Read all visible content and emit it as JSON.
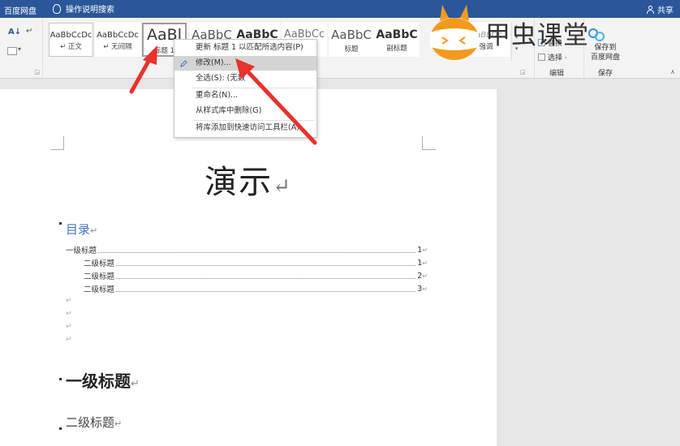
{
  "topbar": {
    "baidu_label": "百度网盘",
    "tell_me": "操作说明搜索",
    "share_label": "共享"
  },
  "ribbon": {
    "styles": [
      {
        "preview": "AaBbCcDc",
        "name": "↵ 正文"
      },
      {
        "preview": "AaBbCcDc",
        "name": "↵ 无间隔"
      },
      {
        "preview": "AaBl",
        "name": "标题 1"
      },
      {
        "preview": "AaBbC",
        "name": ""
      },
      {
        "preview": "AaBbC",
        "name": ""
      },
      {
        "preview": "AaBbCc",
        "name": ""
      },
      {
        "preview": "AaBbC",
        "name": "标题"
      },
      {
        "preview": "AaBbC",
        "name": "副标题"
      },
      {
        "preview": "AaBbDc",
        "name": "强调"
      }
    ],
    "editing": {
      "replace": "替换",
      "select": "选择 ·",
      "group_label": "编辑"
    },
    "save": {
      "line1": "保存到",
      "line2": "百度网盘",
      "group_label": "保存"
    }
  },
  "context_menu": {
    "items": [
      "更新 标题 1 以匹配所选内容(P)",
      "修改(M)...",
      "全选(S): (无数",
      "重命名(N)...",
      "从样式库中删除(G)",
      "将库添加到快速访问工具栏(A)"
    ]
  },
  "document": {
    "title": "演示",
    "toc_heading": "目录",
    "toc_rows": [
      {
        "text": "一级标题",
        "page": "1"
      },
      {
        "text": "二级标题",
        "page": "1"
      },
      {
        "text": "二级标题",
        "page": "2"
      },
      {
        "text": "二级标题",
        "page": "3"
      }
    ],
    "heading1": "一级标题",
    "heading2": "二级标题",
    "para_mark": "↵"
  },
  "logo": {
    "text": "甲虫课堂"
  },
  "colors": {
    "accent_blue": "#2b579a",
    "arrow_red": "#e8322b",
    "toc_blue": "#4472c4",
    "logo_orange": "#f39a1e"
  }
}
